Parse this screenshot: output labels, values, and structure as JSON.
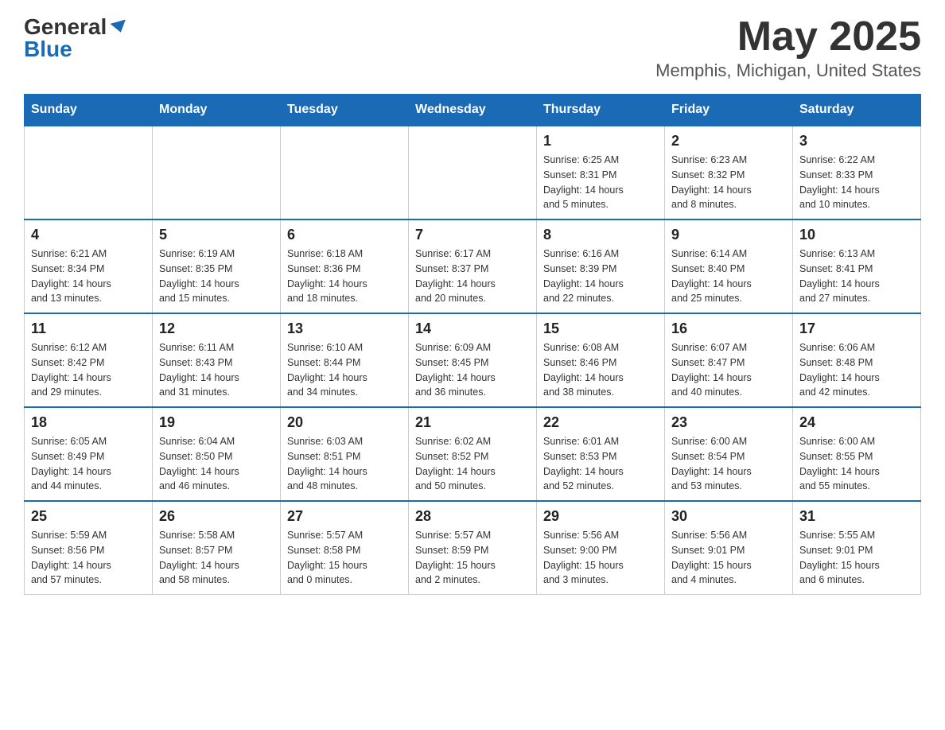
{
  "header": {
    "logo_general": "General",
    "logo_blue": "Blue",
    "month_title": "May 2025",
    "location": "Memphis, Michigan, United States"
  },
  "weekdays": [
    "Sunday",
    "Monday",
    "Tuesday",
    "Wednesday",
    "Thursday",
    "Friday",
    "Saturday"
  ],
  "weeks": [
    [
      {
        "day": "",
        "info": ""
      },
      {
        "day": "",
        "info": ""
      },
      {
        "day": "",
        "info": ""
      },
      {
        "day": "",
        "info": ""
      },
      {
        "day": "1",
        "info": "Sunrise: 6:25 AM\nSunset: 8:31 PM\nDaylight: 14 hours\nand 5 minutes."
      },
      {
        "day": "2",
        "info": "Sunrise: 6:23 AM\nSunset: 8:32 PM\nDaylight: 14 hours\nand 8 minutes."
      },
      {
        "day": "3",
        "info": "Sunrise: 6:22 AM\nSunset: 8:33 PM\nDaylight: 14 hours\nand 10 minutes."
      }
    ],
    [
      {
        "day": "4",
        "info": "Sunrise: 6:21 AM\nSunset: 8:34 PM\nDaylight: 14 hours\nand 13 minutes."
      },
      {
        "day": "5",
        "info": "Sunrise: 6:19 AM\nSunset: 8:35 PM\nDaylight: 14 hours\nand 15 minutes."
      },
      {
        "day": "6",
        "info": "Sunrise: 6:18 AM\nSunset: 8:36 PM\nDaylight: 14 hours\nand 18 minutes."
      },
      {
        "day": "7",
        "info": "Sunrise: 6:17 AM\nSunset: 8:37 PM\nDaylight: 14 hours\nand 20 minutes."
      },
      {
        "day": "8",
        "info": "Sunrise: 6:16 AM\nSunset: 8:39 PM\nDaylight: 14 hours\nand 22 minutes."
      },
      {
        "day": "9",
        "info": "Sunrise: 6:14 AM\nSunset: 8:40 PM\nDaylight: 14 hours\nand 25 minutes."
      },
      {
        "day": "10",
        "info": "Sunrise: 6:13 AM\nSunset: 8:41 PM\nDaylight: 14 hours\nand 27 minutes."
      }
    ],
    [
      {
        "day": "11",
        "info": "Sunrise: 6:12 AM\nSunset: 8:42 PM\nDaylight: 14 hours\nand 29 minutes."
      },
      {
        "day": "12",
        "info": "Sunrise: 6:11 AM\nSunset: 8:43 PM\nDaylight: 14 hours\nand 31 minutes."
      },
      {
        "day": "13",
        "info": "Sunrise: 6:10 AM\nSunset: 8:44 PM\nDaylight: 14 hours\nand 34 minutes."
      },
      {
        "day": "14",
        "info": "Sunrise: 6:09 AM\nSunset: 8:45 PM\nDaylight: 14 hours\nand 36 minutes."
      },
      {
        "day": "15",
        "info": "Sunrise: 6:08 AM\nSunset: 8:46 PM\nDaylight: 14 hours\nand 38 minutes."
      },
      {
        "day": "16",
        "info": "Sunrise: 6:07 AM\nSunset: 8:47 PM\nDaylight: 14 hours\nand 40 minutes."
      },
      {
        "day": "17",
        "info": "Sunrise: 6:06 AM\nSunset: 8:48 PM\nDaylight: 14 hours\nand 42 minutes."
      }
    ],
    [
      {
        "day": "18",
        "info": "Sunrise: 6:05 AM\nSunset: 8:49 PM\nDaylight: 14 hours\nand 44 minutes."
      },
      {
        "day": "19",
        "info": "Sunrise: 6:04 AM\nSunset: 8:50 PM\nDaylight: 14 hours\nand 46 minutes."
      },
      {
        "day": "20",
        "info": "Sunrise: 6:03 AM\nSunset: 8:51 PM\nDaylight: 14 hours\nand 48 minutes."
      },
      {
        "day": "21",
        "info": "Sunrise: 6:02 AM\nSunset: 8:52 PM\nDaylight: 14 hours\nand 50 minutes."
      },
      {
        "day": "22",
        "info": "Sunrise: 6:01 AM\nSunset: 8:53 PM\nDaylight: 14 hours\nand 52 minutes."
      },
      {
        "day": "23",
        "info": "Sunrise: 6:00 AM\nSunset: 8:54 PM\nDaylight: 14 hours\nand 53 minutes."
      },
      {
        "day": "24",
        "info": "Sunrise: 6:00 AM\nSunset: 8:55 PM\nDaylight: 14 hours\nand 55 minutes."
      }
    ],
    [
      {
        "day": "25",
        "info": "Sunrise: 5:59 AM\nSunset: 8:56 PM\nDaylight: 14 hours\nand 57 minutes."
      },
      {
        "day": "26",
        "info": "Sunrise: 5:58 AM\nSunset: 8:57 PM\nDaylight: 14 hours\nand 58 minutes."
      },
      {
        "day": "27",
        "info": "Sunrise: 5:57 AM\nSunset: 8:58 PM\nDaylight: 15 hours\nand 0 minutes."
      },
      {
        "day": "28",
        "info": "Sunrise: 5:57 AM\nSunset: 8:59 PM\nDaylight: 15 hours\nand 2 minutes."
      },
      {
        "day": "29",
        "info": "Sunrise: 5:56 AM\nSunset: 9:00 PM\nDaylight: 15 hours\nand 3 minutes."
      },
      {
        "day": "30",
        "info": "Sunrise: 5:56 AM\nSunset: 9:01 PM\nDaylight: 15 hours\nand 4 minutes."
      },
      {
        "day": "31",
        "info": "Sunrise: 5:55 AM\nSunset: 9:01 PM\nDaylight: 15 hours\nand 6 minutes."
      }
    ]
  ]
}
